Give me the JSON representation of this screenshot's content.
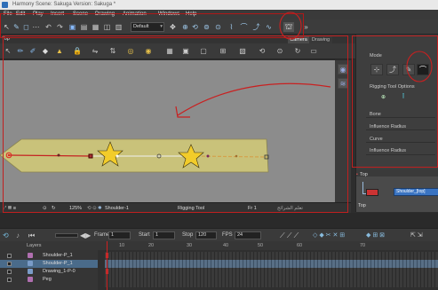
{
  "window": {
    "title": "Harmony Scene: Sakuga Version: Sakuga *"
  },
  "menu": {
    "items": [
      "File",
      "Edit",
      "Play",
      "Insert",
      "Scene",
      "Drawing",
      "Animation",
      "Windows",
      "Help"
    ]
  },
  "toolbar": {
    "preset": "Default"
  },
  "tabs": {
    "top": "Top",
    "camera": "Camera",
    "drawing": "Drawing"
  },
  "viewport": {
    "zoom": "125%",
    "node": "Shoulder-1",
    "tool": "Rigging Tool",
    "frame": "Fr 1",
    "watermark": "تعلم الشرائح"
  },
  "tool_properties": {
    "mode_label": "Mode",
    "options_label": "Rigging Tool Options",
    "bone": "Bone",
    "influence_radius_1": "Influence Radius",
    "curve": "Curve",
    "influence_radius_2": "Influence Radius"
  },
  "node_view": {
    "top_label": "Top",
    "shoulder_label": "Shoulder_[top]",
    "bottom_label": "Top"
  },
  "timeline": {
    "layers_label": "Layers",
    "frame_label": "Frame",
    "frame_value": "1",
    "start_label": "Start",
    "start_value": "1",
    "stop_label": "Stop",
    "stop_value": "120",
    "fps_label": "FPS",
    "fps_value": "24",
    "ruler": [
      "10",
      "20",
      "30",
      "40",
      "50",
      "60",
      "70"
    ],
    "layers": [
      {
        "name": "Shoulder-P_1"
      },
      {
        "name": "Shoulder-P_1"
      },
      {
        "name": "Drawing_1-P-0"
      },
      {
        "name": "Peg"
      }
    ]
  },
  "colors": {
    "accent": "#c02020",
    "shape_fill": "#c9c27a",
    "star": "#f2cc2a",
    "bone": "#d4a24c",
    "node_blue": "#3a74c2"
  }
}
